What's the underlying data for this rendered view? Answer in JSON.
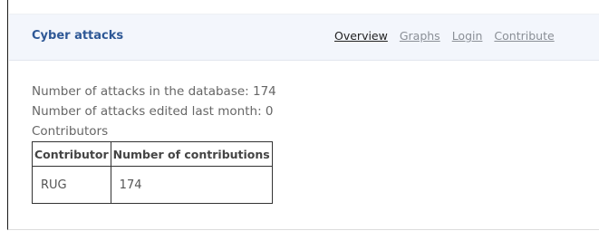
{
  "navbar": {
    "brand": "Cyber attacks",
    "links": [
      {
        "label": "Overview",
        "active": true
      },
      {
        "label": "Graphs",
        "active": false
      },
      {
        "label": "Login",
        "active": false
      },
      {
        "label": "Contribute",
        "active": false
      }
    ]
  },
  "stats": {
    "attacks_total": "Number of attacks in the database: 174",
    "attacks_last_month": "Number of attacks edited last month: 0",
    "contributors_heading": "Contributors"
  },
  "contributors_table": {
    "headers": [
      "Contributor",
      "Number of contributions"
    ],
    "rows": [
      [
        "RUG",
        "174"
      ]
    ]
  },
  "colors": {
    "brand": "#2e5896",
    "navbar_bg": "#f3f6fc",
    "active_link": "#222222",
    "inactive_link": "#8a8f96"
  }
}
